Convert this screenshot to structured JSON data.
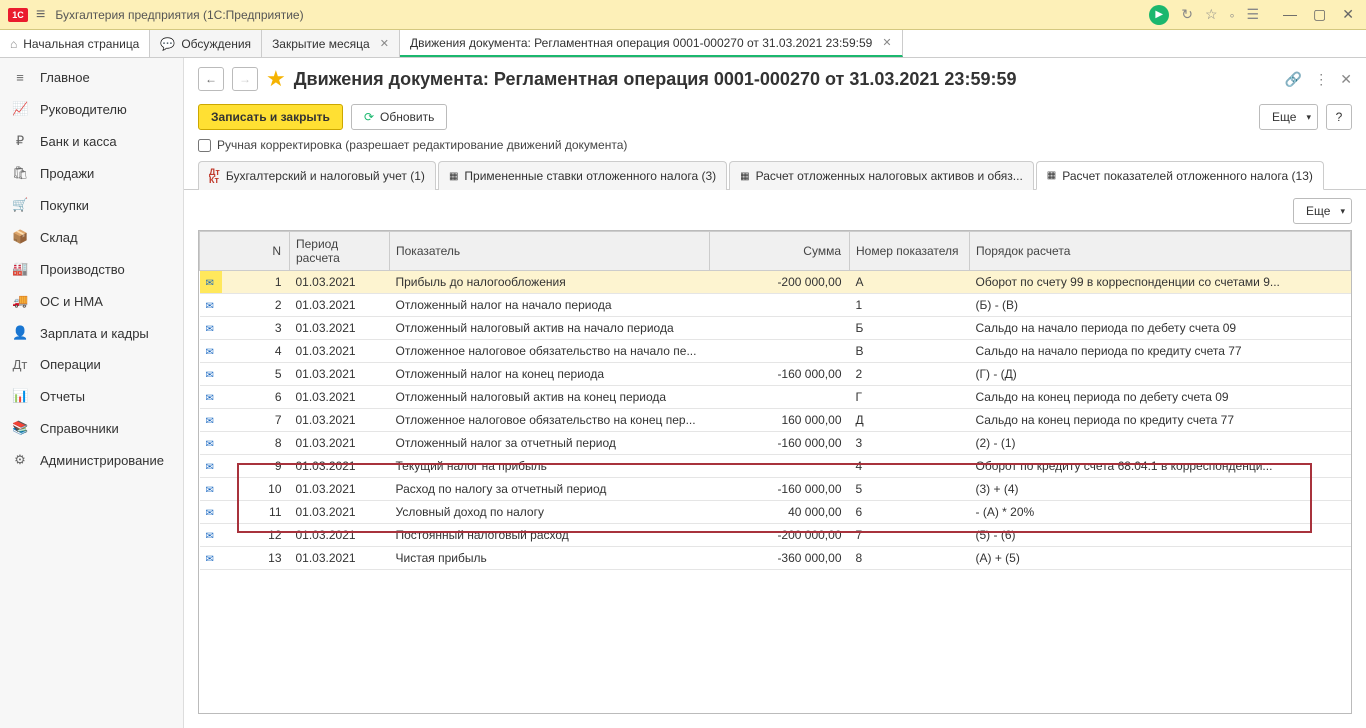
{
  "app": {
    "title": "Бухгалтерия предприятия  (1С:Предприятие)"
  },
  "tabs": {
    "home": "Начальная страница",
    "discuss": "Обсуждения",
    "closing": "Закрытие месяца",
    "doc": "Движения документа: Регламентная операция 0001-000270 от 31.03.2021 23:59:59"
  },
  "sidebar": {
    "items": [
      {
        "icon": "≡",
        "label": "Главное"
      },
      {
        "icon": "📈",
        "label": "Руководителю"
      },
      {
        "icon": "₽",
        "label": "Банк и касса"
      },
      {
        "icon": "🛍",
        "label": "Продажи"
      },
      {
        "icon": "🛒",
        "label": "Покупки"
      },
      {
        "icon": "📦",
        "label": "Склад"
      },
      {
        "icon": "🏭",
        "label": "Производство"
      },
      {
        "icon": "🚚",
        "label": "ОС и НМА"
      },
      {
        "icon": "👤",
        "label": "Зарплата и кадры"
      },
      {
        "icon": "Дт",
        "label": "Операции"
      },
      {
        "icon": "📊",
        "label": "Отчеты"
      },
      {
        "icon": "📚",
        "label": "Справочники"
      },
      {
        "icon": "⚙",
        "label": "Администрирование"
      }
    ]
  },
  "page": {
    "title": "Движения документа: Регламентная операция 0001-000270 от 31.03.2021 23:59:59",
    "save_close": "Записать и закрыть",
    "refresh": "Обновить",
    "more": "Еще",
    "help": "?",
    "manual_label": "Ручная корректировка (разрешает редактирование движений документа)"
  },
  "subtabs": [
    "Бухгалтерский и налоговый учет (1)",
    "Примененные ставки отложенного налога (3)",
    "Расчет отложенных налоговых активов и обяз...",
    "Расчет показателей отложенного налога (13)"
  ],
  "columns": {
    "n": "N",
    "period": "Период расчета",
    "indicator": "Показатель",
    "sum": "Сумма",
    "num": "Номер показателя",
    "order": "Порядок расчета"
  },
  "rows": [
    {
      "n": "1",
      "period": "01.03.2021",
      "ind": "Прибыль до налогообложения",
      "sum": "-200 000,00",
      "num": "А",
      "ord": "Оборот по счету 99 в корреспонденции со счетами 9..."
    },
    {
      "n": "2",
      "period": "01.03.2021",
      "ind": "Отложенный налог на начало периода",
      "sum": "",
      "num": "1",
      "ord": "(Б) - (В)"
    },
    {
      "n": "3",
      "period": "01.03.2021",
      "ind": "Отложенный налоговый актив на начало периода",
      "sum": "",
      "num": "Б",
      "ord": "Сальдо на начало периода по дебету счета 09"
    },
    {
      "n": "4",
      "period": "01.03.2021",
      "ind": "Отложенное налоговое обязательство на начало пе...",
      "sum": "",
      "num": "В",
      "ord": "Сальдо на начало периода по кредиту счета 77"
    },
    {
      "n": "5",
      "period": "01.03.2021",
      "ind": "Отложенный налог на конец периода",
      "sum": "-160 000,00",
      "num": "2",
      "ord": "(Г) - (Д)"
    },
    {
      "n": "6",
      "period": "01.03.2021",
      "ind": "Отложенный налоговый актив на конец периода",
      "sum": "",
      "num": "Г",
      "ord": "Сальдо на конец периода по дебету счета 09"
    },
    {
      "n": "7",
      "period": "01.03.2021",
      "ind": "Отложенное налоговое обязательство на конец пер...",
      "sum": "160 000,00",
      "num": "Д",
      "ord": "Сальдо на конец периода по кредиту счета  77"
    },
    {
      "n": "8",
      "period": "01.03.2021",
      "ind": "Отложенный налог за отчетный период",
      "sum": "-160 000,00",
      "num": "3",
      "ord": "(2) - (1)"
    },
    {
      "n": "9",
      "period": "01.03.2021",
      "ind": "Текущий налог на прибыль",
      "sum": "",
      "num": "4",
      "ord": "Оборот по кредиту счета 68.04.1 в корреспонденци..."
    },
    {
      "n": "10",
      "period": "01.03.2021",
      "ind": "Расход по налогу за отчетный период",
      "sum": "-160 000,00",
      "num": "5",
      "ord": "(3) + (4)"
    },
    {
      "n": "11",
      "period": "01.03.2021",
      "ind": "Условный доход по налогу",
      "sum": "40 000,00",
      "num": "6",
      "ord": "- (А) * 20%"
    },
    {
      "n": "12",
      "period": "01.03.2021",
      "ind": "Постоянный налоговый расход",
      "sum": "-200 000,00",
      "num": "7",
      "ord": "(5) - (6)"
    },
    {
      "n": "13",
      "period": "01.03.2021",
      "ind": "Чистая прибыль",
      "sum": "-360 000,00",
      "num": "8",
      "ord": "(А) + (5)"
    }
  ]
}
